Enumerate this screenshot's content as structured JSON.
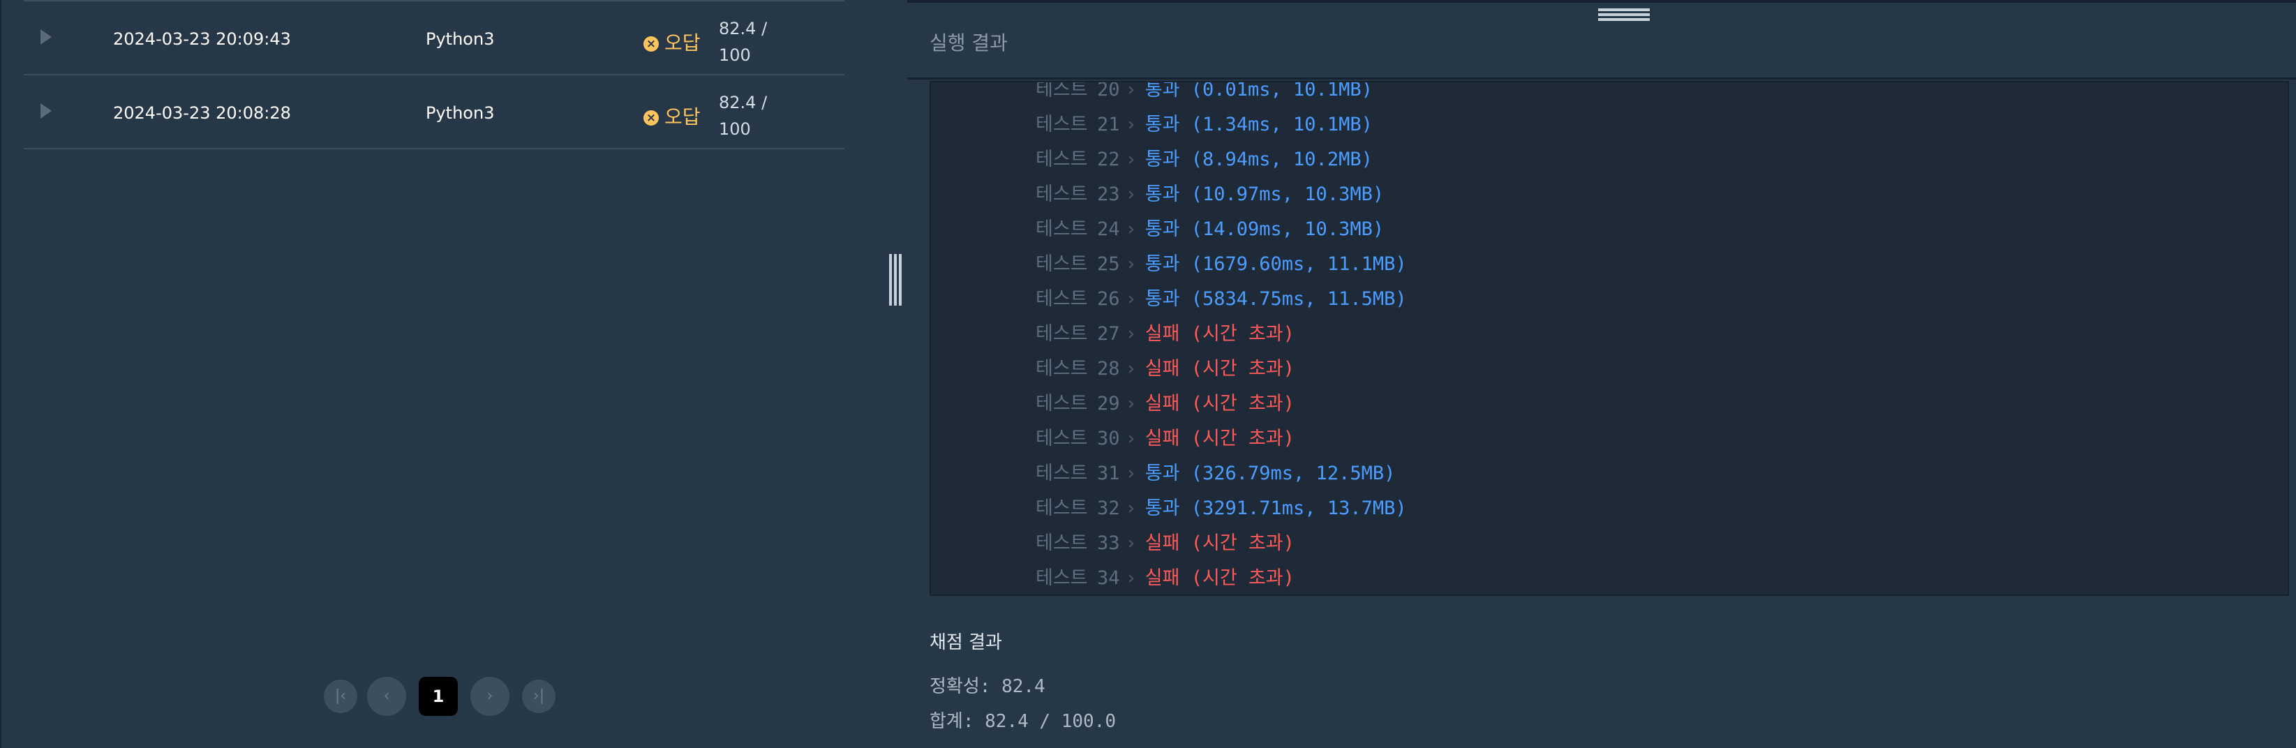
{
  "submissions": [
    {
      "date": "2024-03-23 20:09:43",
      "language": "Python3",
      "result": "오답",
      "score_line1": "82.4 /",
      "score_line2": "100"
    },
    {
      "date": "2024-03-23 20:08:28",
      "language": "Python3",
      "result": "오답",
      "score_line1": "82.4 /",
      "score_line2": "100"
    }
  ],
  "pagination": {
    "first": "|‹",
    "prev": "‹",
    "current": "1",
    "next": "›",
    "last": "›|"
  },
  "results_panel": {
    "title": "실행 결과"
  },
  "tests": [
    {
      "label": "테스트",
      "num": "20",
      "status": "통과",
      "detail": "(0.01ms, 10.1MB)",
      "pass": true
    },
    {
      "label": "테스트",
      "num": "21",
      "status": "통과",
      "detail": "(1.34ms, 10.1MB)",
      "pass": true
    },
    {
      "label": "테스트",
      "num": "22",
      "status": "통과",
      "detail": "(8.94ms, 10.2MB)",
      "pass": true
    },
    {
      "label": "테스트",
      "num": "23",
      "status": "통과",
      "detail": "(10.97ms, 10.3MB)",
      "pass": true
    },
    {
      "label": "테스트",
      "num": "24",
      "status": "통과",
      "detail": "(14.09ms, 10.3MB)",
      "pass": true
    },
    {
      "label": "테스트",
      "num": "25",
      "status": "통과",
      "detail": "(1679.60ms, 11.1MB)",
      "pass": true
    },
    {
      "label": "테스트",
      "num": "26",
      "status": "통과",
      "detail": "(5834.75ms, 11.5MB)",
      "pass": true
    },
    {
      "label": "테스트",
      "num": "27",
      "status": "실패",
      "detail": "(시간 초과)",
      "pass": false
    },
    {
      "label": "테스트",
      "num": "28",
      "status": "실패",
      "detail": "(시간 초과)",
      "pass": false
    },
    {
      "label": "테스트",
      "num": "29",
      "status": "실패",
      "detail": "(시간 초과)",
      "pass": false
    },
    {
      "label": "테스트",
      "num": "30",
      "status": "실패",
      "detail": "(시간 초과)",
      "pass": false
    },
    {
      "label": "테스트",
      "num": "31",
      "status": "통과",
      "detail": "(326.79ms, 12.5MB)",
      "pass": true
    },
    {
      "label": "테스트",
      "num": "32",
      "status": "통과",
      "detail": "(3291.71ms, 13.7MB)",
      "pass": true
    },
    {
      "label": "테스트",
      "num": "33",
      "status": "실패",
      "detail": "(시간 초과)",
      "pass": false
    },
    {
      "label": "테스트",
      "num": "34",
      "status": "실패",
      "detail": "(시간 초과)",
      "pass": false
    }
  ],
  "grading": {
    "title": "채점 결과",
    "accuracy": "정확성: 82.4",
    "total": "합계: 82.4 / 100.0"
  },
  "colors": {
    "pass": "#4c9dff",
    "fail": "#ff5a5a",
    "wrong_answer": "#ffc45c"
  }
}
